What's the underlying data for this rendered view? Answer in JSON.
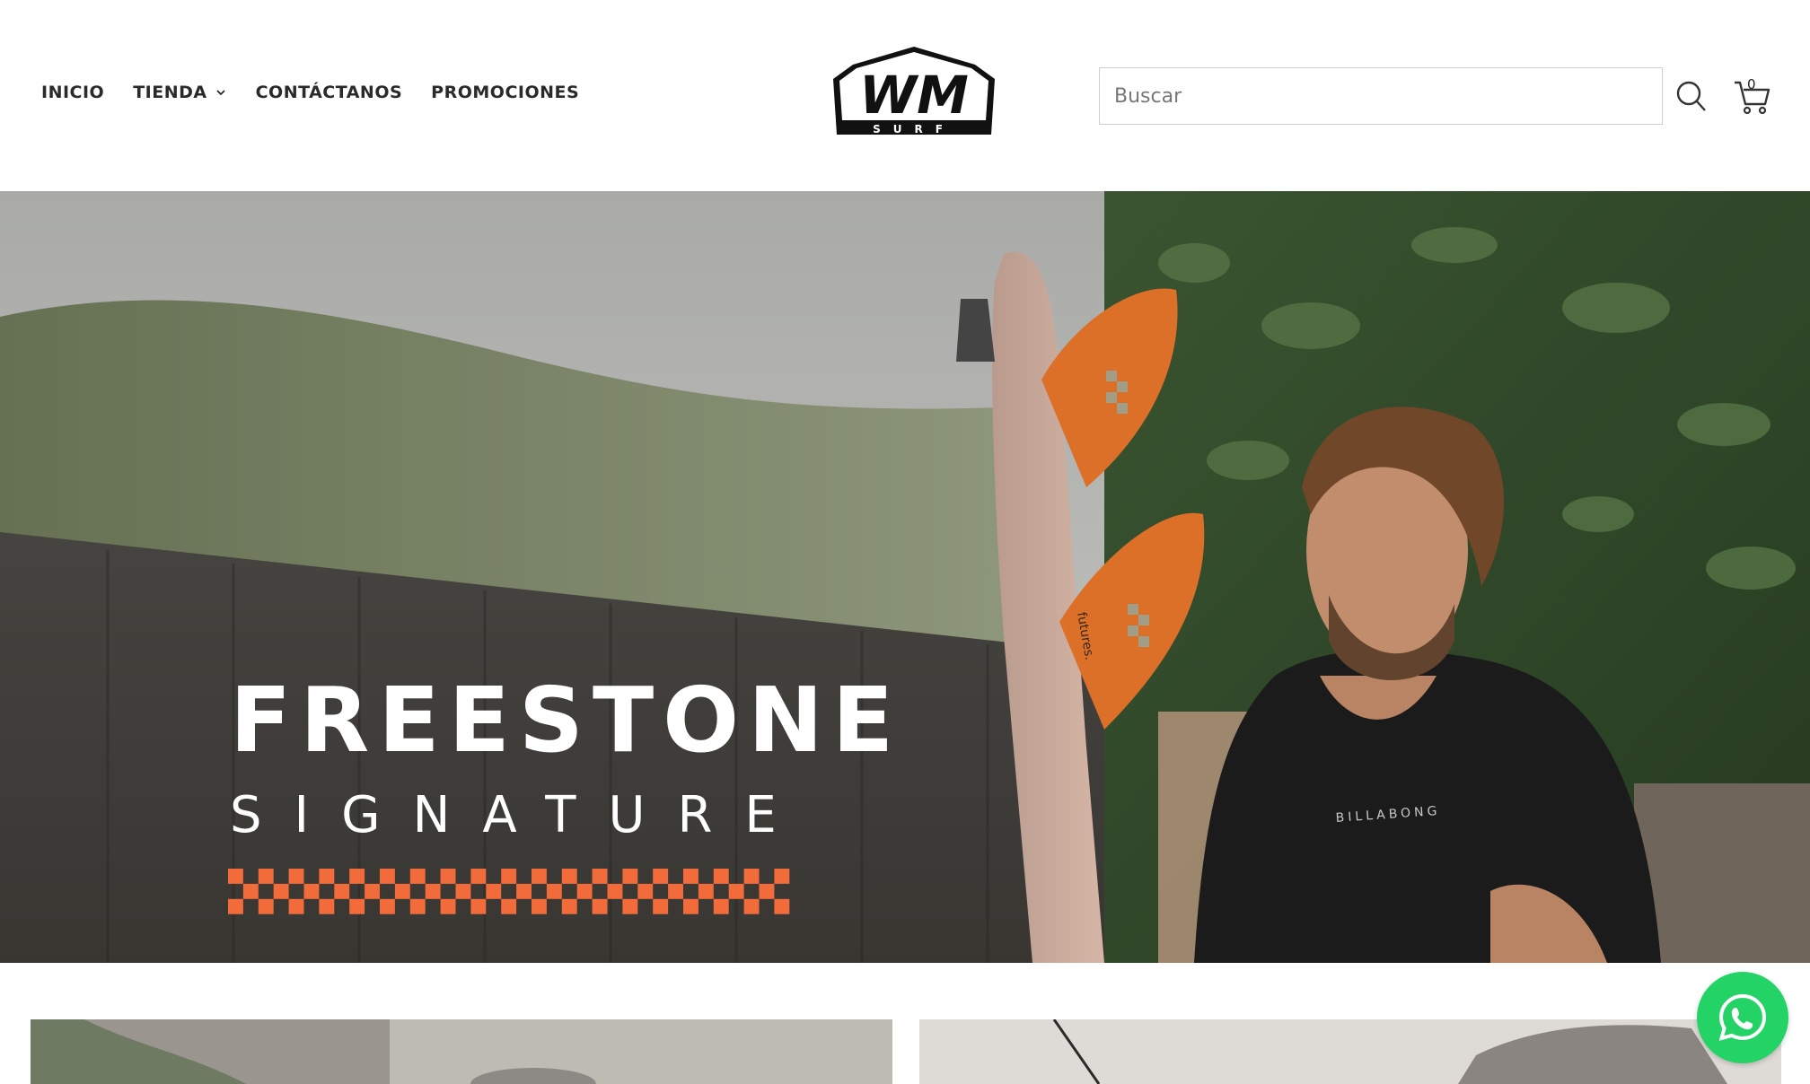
{
  "nav": {
    "items": [
      {
        "label": "INICIO"
      },
      {
        "label": "TIENDA",
        "has_dropdown": true
      },
      {
        "label": "CONTÁCTANOS"
      },
      {
        "label": "PROMOCIONES"
      }
    ]
  },
  "logo": {
    "main": "WM",
    "sub": "SURF"
  },
  "search": {
    "placeholder": "Buscar",
    "value": ""
  },
  "cart": {
    "count": "0"
  },
  "hero": {
    "title": "FREESTONE",
    "subtitle": "SIGNATURE",
    "fin_brand": "futures.",
    "shirt_brand": "BILLABONG",
    "slides": 2,
    "active_slide": 1
  },
  "colors": {
    "accent_orange": "#f26b3a",
    "whatsapp_green": "#23d366",
    "text_dark": "#2a2a2a"
  },
  "icons": [
    "chevron-down-icon",
    "search-icon",
    "cart-icon",
    "whatsapp-icon"
  ]
}
